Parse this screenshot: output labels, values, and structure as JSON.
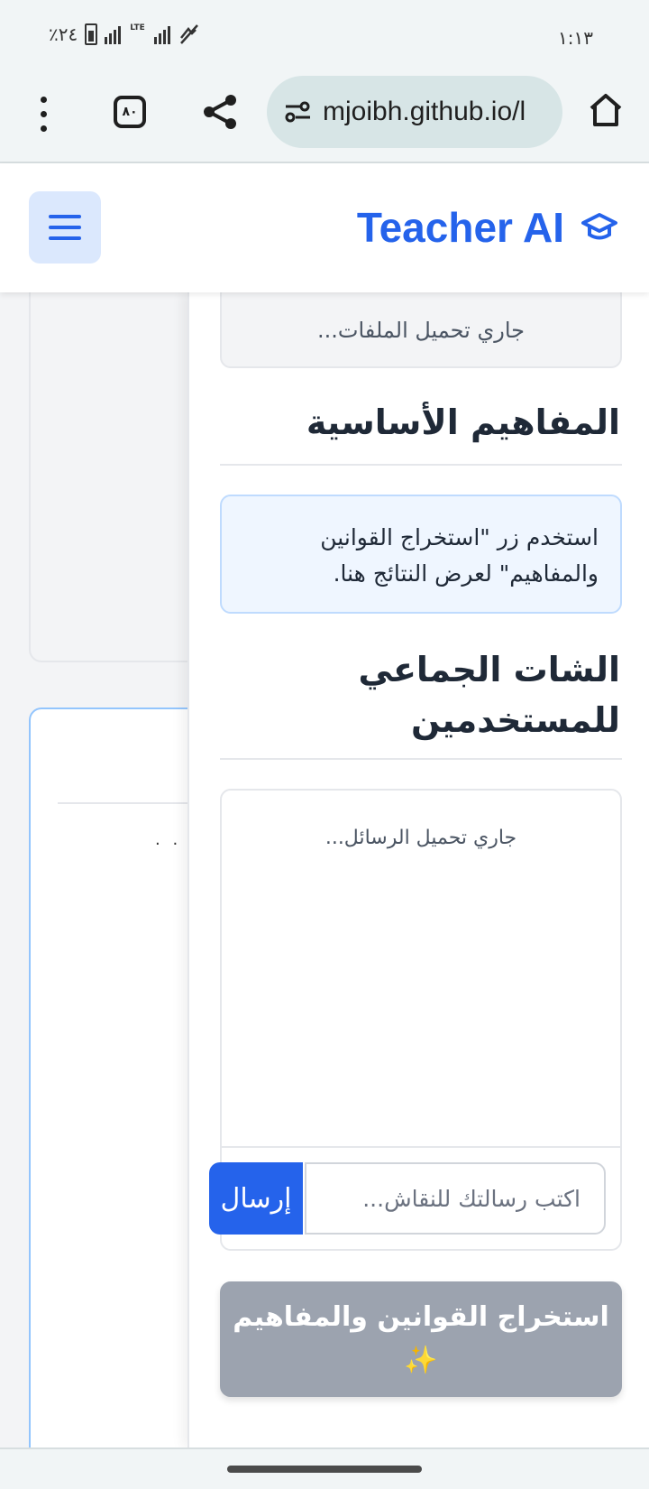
{
  "status_bar": {
    "time": "١:١٣",
    "battery": "٪٢٤",
    "network": "LTE"
  },
  "browser": {
    "url": "mjoibh.github.io/l",
    "tab_count": "٨٠"
  },
  "header": {
    "title": "Teacher AI"
  },
  "background": {
    "dots": ". ."
  },
  "panel": {
    "files_loading": "جاري تحميل الملفات...",
    "concepts_title": "المفاهيم الأساسية",
    "concepts_hint": "استخدم زر \"استخراج القوانين والمفاهيم\" لعرض النتائج هنا.",
    "chat_title": "الشات الجماعي للمستخدمين",
    "messages_loading": "جاري تحميل الرسائل...",
    "chat_placeholder": "اكتب رسالتك للنقاش...",
    "send_label": "إرسال",
    "extract_label": "استخراج القوانين والمفاهيم ✨"
  }
}
